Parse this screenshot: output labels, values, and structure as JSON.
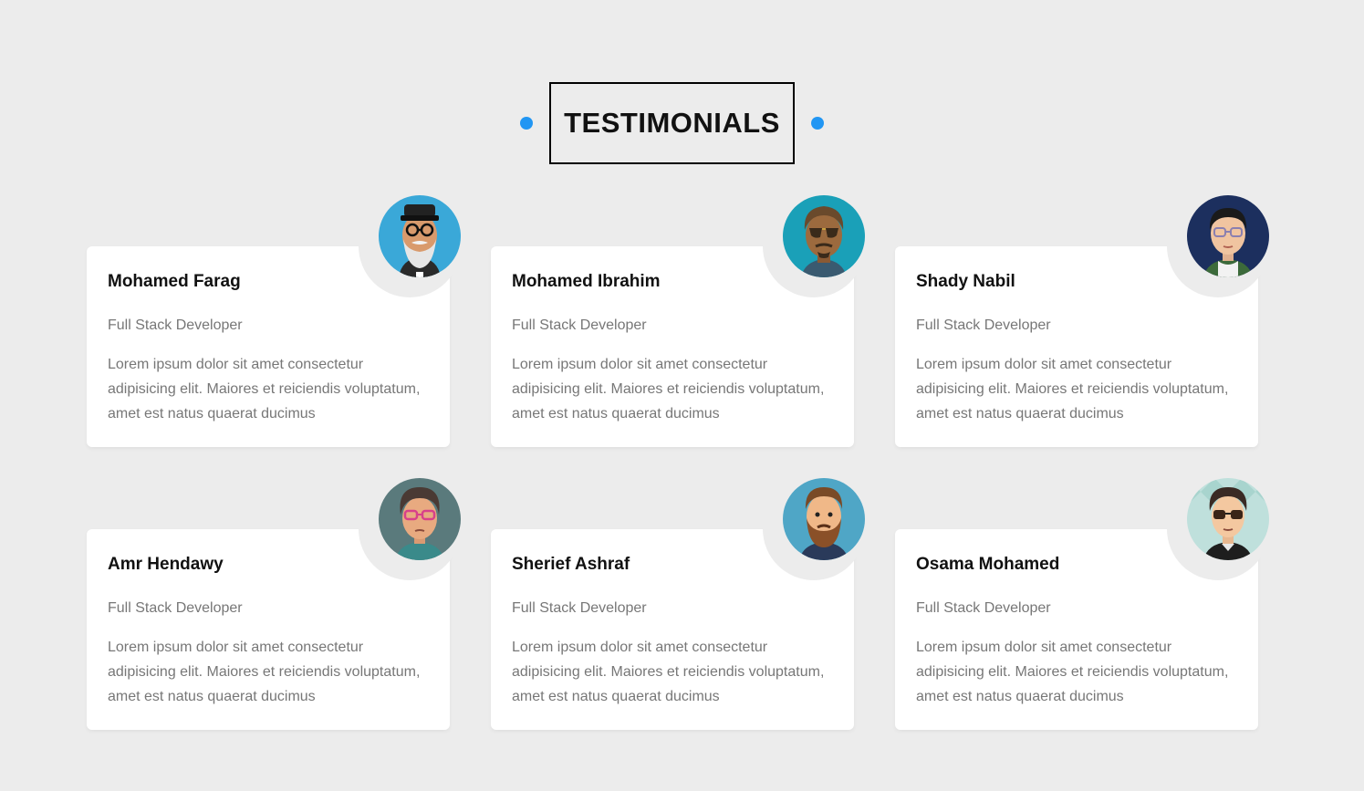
{
  "section": {
    "title": "TESTIMONIALS",
    "accent_color": "#2196f3"
  },
  "testimonials": [
    {
      "name": "Mohamed Farag",
      "role": "Full Stack Developer",
      "text": "Lorem ipsum dolor sit amet consectetur adipisicing elit. Maiores et reiciendis voluptatum, amet est natus quaerat ducimus",
      "avatar_icon": "avatar-bearded-hat-icon"
    },
    {
      "name": "Mohamed Ibrahim",
      "role": "Full Stack Developer",
      "text": "Lorem ipsum dolor sit amet consectetur adipisicing elit. Maiores et reiciendis voluptatum, amet est natus quaerat ducimus",
      "avatar_icon": "avatar-sunglasses-icon"
    },
    {
      "name": "Shady Nabil",
      "role": "Full Stack Developer",
      "text": "Lorem ipsum dolor sit amet consectetur adipisicing elit. Maiores et reiciendis voluptatum, amet est natus quaerat ducimus",
      "avatar_icon": "avatar-glasses-icon"
    },
    {
      "name": "Amr Hendawy",
      "role": "Full Stack Developer",
      "text": "Lorem ipsum dolor sit amet consectetur adipisicing elit. Maiores et reiciendis voluptatum, amet est natus quaerat ducimus",
      "avatar_icon": "avatar-pink-glasses-icon"
    },
    {
      "name": "Sherief Ashraf",
      "role": "Full Stack Developer",
      "text": "Lorem ipsum dolor sit amet consectetur adipisicing elit. Maiores et reiciendis voluptatum, amet est natus quaerat ducimus",
      "avatar_icon": "avatar-beard-icon"
    },
    {
      "name": "Osama Mohamed",
      "role": "Full Stack Developer",
      "text": "Lorem ipsum dolor sit amet consectetur adipisicing elit. Maiores et reiciendis voluptatum, amet est natus quaerat ducimus",
      "avatar_icon": "avatar-dark-glasses-icon"
    }
  ]
}
